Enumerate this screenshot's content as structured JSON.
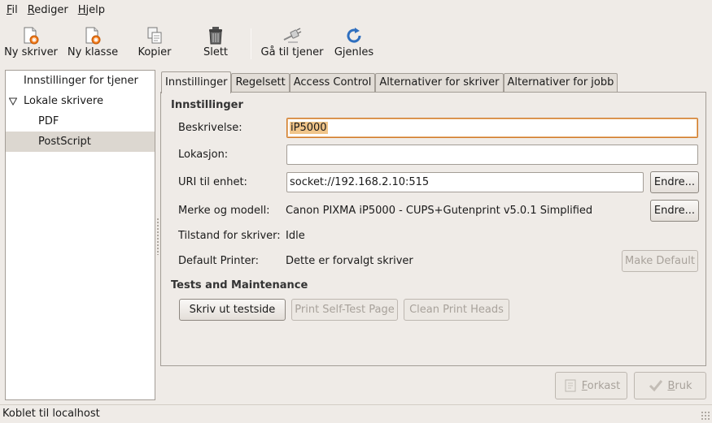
{
  "menubar": [
    {
      "mnemonic": "F",
      "rest": "il"
    },
    {
      "mnemonic": "R",
      "rest": "ediger"
    },
    {
      "mnemonic": "H",
      "rest": "jelp"
    }
  ],
  "toolbar": {
    "new_printer": "Ny skriver",
    "new_class": "Ny klasse",
    "copy": "Kopier",
    "delete": "Slett",
    "goto_server": "Gå til tjener",
    "refresh": "Gjenles"
  },
  "sidebar": {
    "server_settings": "Innstillinger for tjener",
    "local_printers": "Lokale skrivere",
    "printers": [
      "PDF",
      "PostScript"
    ]
  },
  "tabs": [
    "Innstillinger",
    "Regelsett",
    "Access Control",
    "Alternativer for skriver",
    "Alternativer for jobb"
  ],
  "settings": {
    "section_title": "Innstillinger",
    "description_label": "Beskrivelse:",
    "description_value": "iP5000",
    "location_label": "Lokasjon:",
    "location_value": "",
    "uri_label": "URI til enhet:",
    "uri_value": "socket://192.168.2.10:515",
    "change_label": "Endre...",
    "model_label": "Merke og modell:",
    "model_value": "Canon PIXMA iP5000 - CUPS+Gutenprint v5.0.1 Simplified",
    "state_label": "Tilstand for skriver:",
    "state_value": "Idle",
    "default_label": "Default Printer:",
    "default_value": "Dette er forvalgt skriver",
    "make_default": "Make Default"
  },
  "tests": {
    "section_title": "Tests and Maintenance",
    "print_test": "Skriv ut testside",
    "self_test": "Print Self-Test Page",
    "clean_heads": "Clean Print Heads"
  },
  "dialog": {
    "revert_mnemonic": "F",
    "revert_rest": "orkast",
    "apply_mnemonic": "B",
    "apply_rest": "ruk"
  },
  "status": "Koblet til localhost"
}
